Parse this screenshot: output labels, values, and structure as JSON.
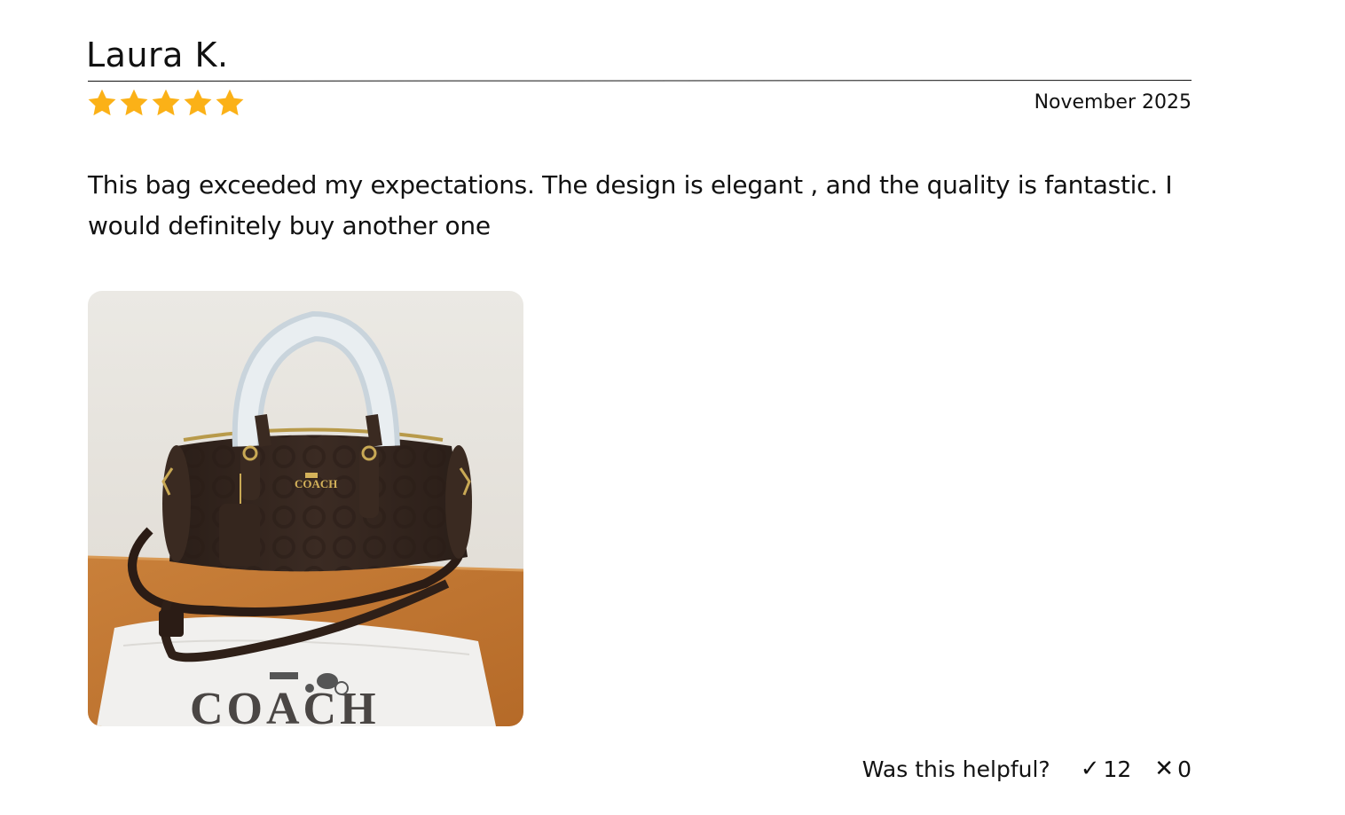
{
  "review": {
    "reviewer": "Laura K.",
    "rating": 5,
    "rating_max": 5,
    "date": "November 2025",
    "body": "This bag exceeded my expectations. The design is elegant , and the quality is fantastic. I would definitely buy another one",
    "photo": {
      "brand_text_bag": "COACH",
      "brand_text_dustbag": "COACH"
    }
  },
  "helpful": {
    "label": "Was this helpful?",
    "yes_icon": "✓",
    "yes_count": "12",
    "no_icon": "✕",
    "no_count": "0"
  },
  "colors": {
    "star": "#FBB117",
    "text": "#111111",
    "divider": "#111111"
  }
}
